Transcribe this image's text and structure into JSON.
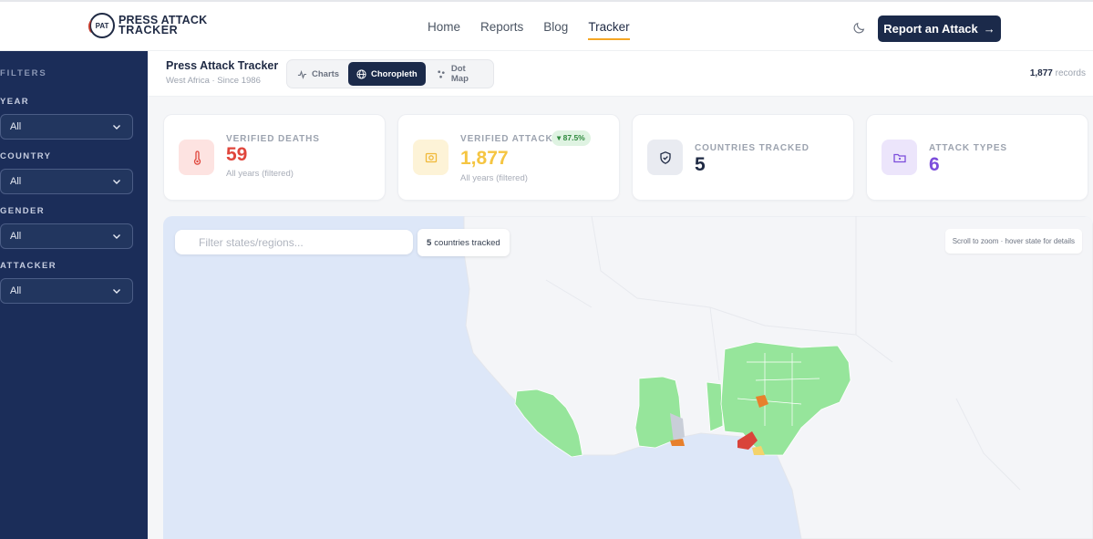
{
  "brand": {
    "line1": "PRESS ATTACK",
    "line2": "TRACKER"
  },
  "nav": [
    {
      "label": "Home"
    },
    {
      "label": "Reports"
    },
    {
      "label": "Blog"
    },
    {
      "label": "Tracker"
    }
  ],
  "cta_label": "Report an Attack",
  "sidebar": {
    "title": "FILTERS",
    "filters": [
      {
        "label": "YEAR",
        "value": "All"
      },
      {
        "label": "COUNTRY",
        "value": "All"
      },
      {
        "label": "GENDER",
        "value": "All"
      },
      {
        "label": "ATTACKER",
        "value": "All"
      }
    ]
  },
  "header": {
    "title": "Press Attack Tracker",
    "subtitle": "West Africa · Since 1986",
    "tabs": [
      {
        "label": "Charts"
      },
      {
        "label": "Choropleth"
      },
      {
        "label": "Dot Map"
      }
    ],
    "records_count": "1,877",
    "records_label": "records"
  },
  "stats": [
    {
      "label": "VERIFIED DEATHS",
      "value": "59",
      "sub": "All years (filtered)",
      "color": "#e0463c",
      "icon": "thermometer-icon"
    },
    {
      "label": "VERIFIED ATTACKS",
      "value": "1,877",
      "sub": "All years (filtered)",
      "color": "#f5c542",
      "badge": "▾ 87.5%",
      "icon": "camera-icon"
    },
    {
      "label": "COUNTRIES TRACKED",
      "value": "5",
      "color": "#1f2a44",
      "icon": "shield-icon"
    },
    {
      "label": "ATTACK TYPES",
      "value": "6",
      "color": "#7c4ddb",
      "icon": "folder-icon"
    }
  ],
  "map": {
    "search_placeholder": "Filter states/regions...",
    "countries_count": "5",
    "countries_label": "countries tracked",
    "hint": "Scroll to zoom · hover state for details"
  },
  "colors": {
    "navy": "#1b2a4a",
    "sidebar": "#1b2d59",
    "accent": "#f5a623",
    "land": "#f4f5f8",
    "ocean": "#dde7f8",
    "region_green": "#96e59b",
    "region_red": "#d9443a",
    "region_orange": "#e7802c",
    "region_yellow": "#f4d36b"
  }
}
